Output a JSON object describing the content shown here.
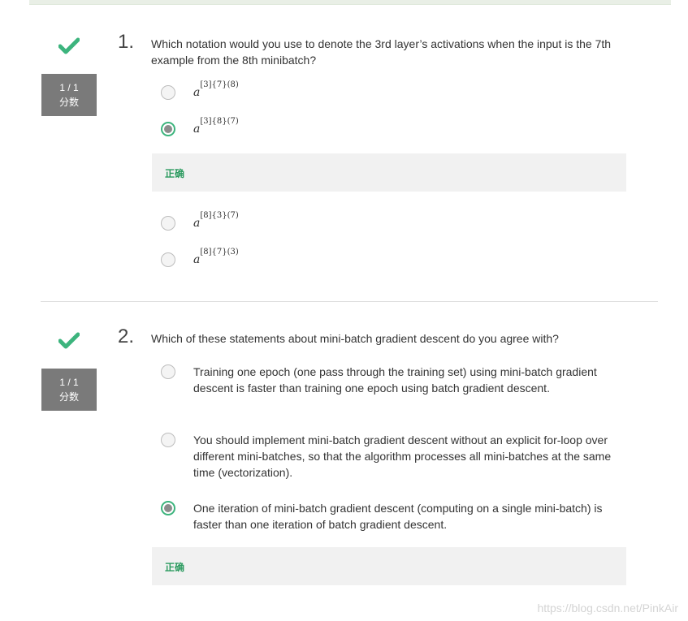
{
  "colors": {
    "accent_green": "#3cb47d",
    "badge_gray": "#7a7a7a",
    "feedback_bg": "#f1f1f1"
  },
  "questions": [
    {
      "number": "1.",
      "text": "Which notation would you use to denote the 3rd layer’s activations when the input is the 7th example from the 8th minibatch?",
      "score": "1 / 1",
      "score_unit": "分数",
      "status_icon": "check-icon",
      "options": [
        {
          "base": "a",
          "sup": "[3]{7}(8)",
          "selected": false
        },
        {
          "base": "a",
          "sup": "[3]{8}(7)",
          "selected": true,
          "feedback": "正确"
        },
        {
          "base": "a",
          "sup": "[8]{3}(7)",
          "selected": false
        },
        {
          "base": "a",
          "sup": "[8]{7}(3)",
          "selected": false
        }
      ]
    },
    {
      "number": "2.",
      "text": "Which of these statements about mini-batch gradient descent do you agree with?",
      "score": "1 / 1",
      "score_unit": "分数",
      "status_icon": "check-icon",
      "options": [
        {
          "text": "Training one epoch (one pass through the training set) using mini-batch gradient descent is faster than training one epoch using batch gradient descent.",
          "selected": false
        },
        {
          "text": "You should implement mini-batch gradient descent without an explicit for-loop over different mini-batches, so that the algorithm processes all mini-batches at the same time (vectorization).",
          "selected": false
        },
        {
          "text": "One iteration of mini-batch gradient descent (computing on a single mini-batch) is faster than one iteration of batch gradient descent.",
          "selected": true,
          "feedback": "正确"
        }
      ]
    }
  ],
  "watermark": "https://blog.csdn.net/PinkAir"
}
